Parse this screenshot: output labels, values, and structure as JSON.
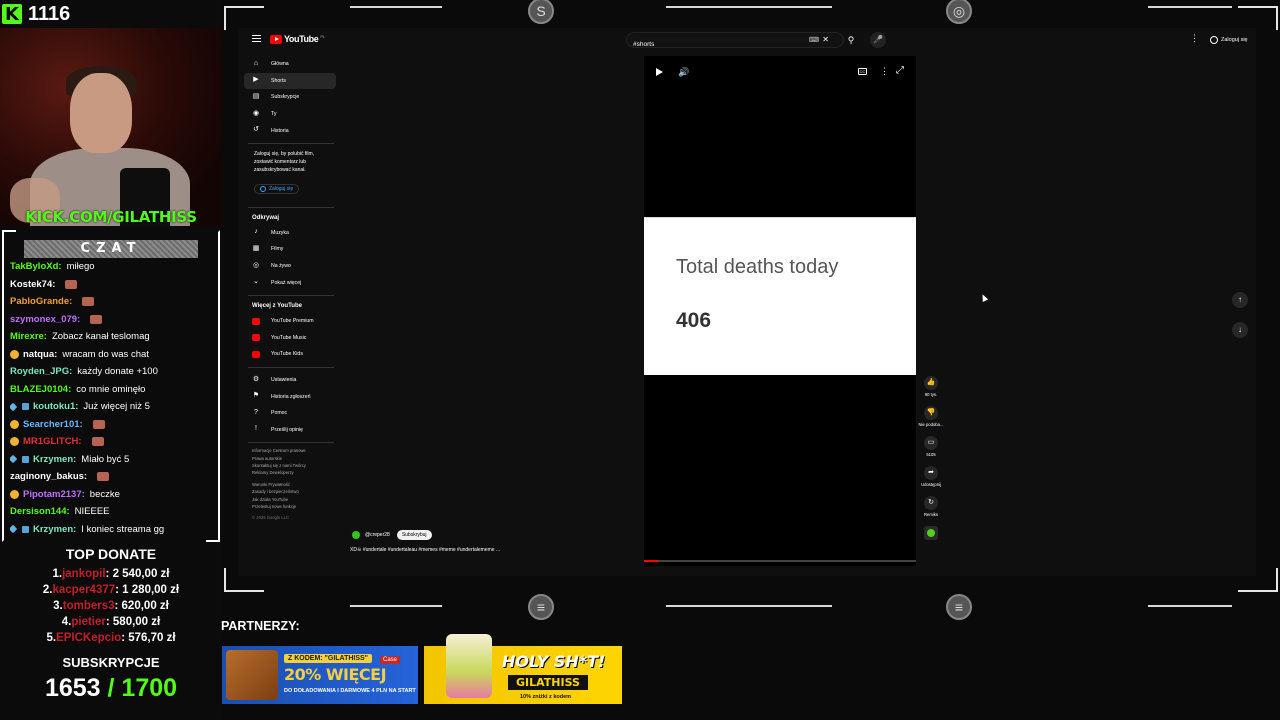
{
  "stream": {
    "viewer_count": "1116",
    "kick_url_prefix": "KICK.COM/",
    "kick_url_name": "GILATHISS",
    "chat_title": "CZAT",
    "chat": [
      {
        "user": "TakByloXd:",
        "color": "#53fc18",
        "msg": "miłego",
        "emote": false,
        "badge": ""
      },
      {
        "user": "Kostek74:",
        "color": "#ffffff",
        "msg": "",
        "emote": true,
        "badge": ""
      },
      {
        "user": "PabloGrande:",
        "color": "#f0a030",
        "msg": "",
        "emote": true,
        "badge": ""
      },
      {
        "user": "szymonex_079:",
        "color": "#c070ff",
        "msg": "",
        "emote": true,
        "badge": ""
      },
      {
        "user": "Mirexre:",
        "color": "#53fc18",
        "msg": "Zobacz kanał teslomag",
        "emote": false,
        "badge": ""
      },
      {
        "user": "natqua:",
        "color": "#ffffff",
        "msg": "wracam do was chat",
        "emote": false,
        "badge": "coin"
      },
      {
        "user": "Royden_JPG:",
        "color": "#7ee8c0",
        "msg": "każdy donate +100",
        "emote": false,
        "badge": ""
      },
      {
        "user": "BLAZEJ0104:",
        "color": "#53fc18",
        "msg": "co mnie ominęło",
        "emote": false,
        "badge": ""
      },
      {
        "user": "koutoku1:",
        "color": "#7ee8c0",
        "msg": "Już więcej niż 5",
        "emote": false,
        "badge": "sword"
      },
      {
        "user": "Searcher101:",
        "color": "#6ab7ff",
        "msg": "",
        "emote": true,
        "badge": "coin"
      },
      {
        "user": "MR1GLITCH:",
        "color": "#e0303a",
        "msg": "",
        "emote": true,
        "badge": "coin"
      },
      {
        "user": "Krzymen:",
        "color": "#7ee8c0",
        "msg": "Miało być 5",
        "emote": false,
        "badge": "sword"
      },
      {
        "user": "zaginony_bakus:",
        "color": "#ffffff",
        "msg": "",
        "emote": true,
        "badge": ""
      },
      {
        "user": "Pipotam2137:",
        "color": "#c070ff",
        "msg": "beczke",
        "emote": false,
        "badge": "coin"
      },
      {
        "user": "Dersison144:",
        "color": "#53fc18",
        "msg": "NIEEEE",
        "emote": false,
        "badge": ""
      },
      {
        "user": "Krzymen:",
        "color": "#7ee8c0",
        "msg": "I koniec streama gg",
        "emote": false,
        "badge": "sword"
      }
    ],
    "top_donate_title": "TOP DONATE",
    "donations": [
      {
        "rank": "1.",
        "name": "jankopil",
        "amount": ": 2 540,00 zł"
      },
      {
        "rank": "2.",
        "name": "kacper4377",
        "amount": ": 1 280,00 zł"
      },
      {
        "rank": "3.",
        "name": "tombers3",
        "amount": ": 620,00 zł"
      },
      {
        "rank": "4.",
        "name": "pietier",
        "amount": ": 580,00 zł"
      },
      {
        "rank": "5.",
        "name": "EPICKepcio",
        "amount": ": 576,70 zł"
      }
    ],
    "subs_title": "SUBSKRYPCJE",
    "subs_current": "1653",
    "subs_goal": " / 1700",
    "partners_label": "PARTNERZY:",
    "banner1": {
      "code": "Z KODEM: \"GILATHISS\"",
      "big": "20% WIĘCEJ",
      "small": "DO DOŁADOWANIA I DARMOWE 4 PLN NA START",
      "logo": "Case"
    },
    "banner2": {
      "holy": "HOLY SH*T!",
      "code": "GILATHISS",
      "discount": "10% zniżki z kodem"
    }
  },
  "youtube": {
    "logo_text": "YouTube",
    "logo_region": "PL",
    "search_value": "#shorts",
    "signin_label": "Zaloguj się",
    "nav_main": [
      {
        "label": "Główna",
        "icon": "⌂"
      },
      {
        "label": "Shorts",
        "icon": "▶"
      },
      {
        "label": "Subskrypcje",
        "icon": "▤"
      },
      {
        "label": "Ty",
        "icon": "◉"
      },
      {
        "label": "Historia",
        "icon": "↺"
      }
    ],
    "login_note": "Zaloguj się, by polubić film, zostawić komentarz lub zasubskrybować kanał.",
    "login_button": "Zaloguj się",
    "explore_title": "Odkrywaj",
    "nav_explore": [
      {
        "label": "Muzyka",
        "icon": "♪"
      },
      {
        "label": "Filmy",
        "icon": "▦"
      },
      {
        "label": "Na żywo",
        "icon": "◎"
      },
      {
        "label": "Pokaż więcej",
        "icon": "⌄"
      }
    ],
    "more_title": "Więcej z YouTube",
    "nav_more": [
      {
        "label": "YouTube Premium"
      },
      {
        "label": "YouTube Music"
      },
      {
        "label": "YouTube Kids"
      }
    ],
    "nav_settings": [
      {
        "label": "Ustawienia",
        "icon": "⚙"
      },
      {
        "label": "Historia zgłoszeń",
        "icon": "⚑"
      },
      {
        "label": "Pomoc",
        "icon": "?"
      },
      {
        "label": "Prześlij opinię",
        "icon": "!"
      }
    ],
    "footer_lines": [
      "Informacje  Centrum prasowe",
      "Prawa autorskie",
      "Skontaktuj się z nami  Twórcy",
      "Reklamy  Deweloperzy",
      "",
      "Warunki  Prywatność",
      "Zasady i bezpieczeństwo",
      "Jak działa YouTube",
      "Przetestuj nowe funkcje"
    ],
    "copyright": "© 2025 Google LLC",
    "video": {
      "card_title": "Total deaths today",
      "card_value": "406",
      "progress": 0.05,
      "channel": "@creper28",
      "subscribe": "Subskrybuj",
      "description": "XD☠ #undertale #undertaleau #memes #meme #undertalememe ..."
    },
    "actions": [
      {
        "icon": "👍",
        "label": "90 tys."
      },
      {
        "icon": "👎",
        "label": "Nie podoba..."
      },
      {
        "icon": "▭",
        "label": "5105"
      },
      {
        "icon": "➦",
        "label": "Udostępnij"
      },
      {
        "icon": "↻",
        "label": "Remiks"
      }
    ]
  }
}
